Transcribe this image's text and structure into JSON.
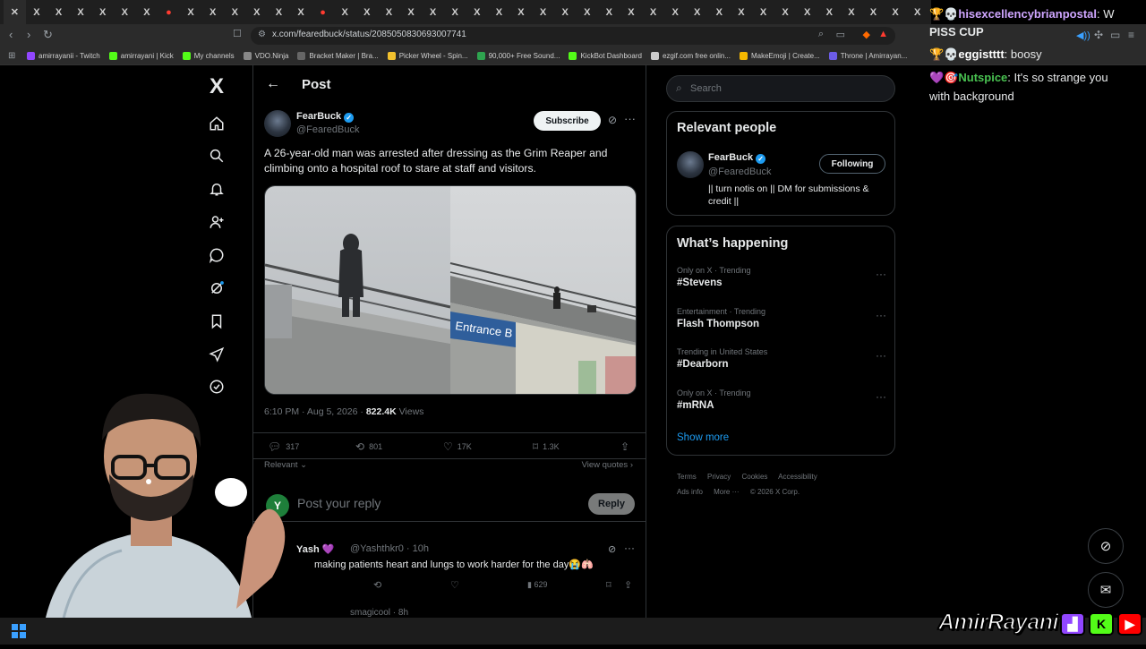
{
  "browser": {
    "url": "x.com/fearedbuck/status/2085050830693007741",
    "tab_favicon_letters": [
      "✕",
      "X",
      "X",
      "X",
      "X",
      "X",
      "X",
      "●",
      "X",
      "X",
      "X",
      "X",
      "X",
      "X",
      "●",
      "X",
      "X",
      "X",
      "X",
      "X",
      "X",
      "X",
      "X",
      "X",
      "X",
      "X",
      "X",
      "X",
      "X",
      "X",
      "X",
      "X",
      "X",
      "X",
      "X",
      "X",
      "X",
      "X",
      "X",
      "X",
      "X",
      "X"
    ],
    "bookmarks": [
      {
        "label": "amirrayanii - Twitch",
        "color": "#9146ff"
      },
      {
        "label": "amirrayani | Kick",
        "color": "#53fc18"
      },
      {
        "label": "My channels",
        "color": "#53fc18"
      },
      {
        "label": "VDO.Ninja",
        "color": "#888888"
      },
      {
        "label": "Bracket Maker | Bra...",
        "color": "#666666"
      },
      {
        "label": "Picker Wheel - Spin...",
        "color": "#f2c12e"
      },
      {
        "label": "90,000+ Free Sound...",
        "color": "#2ea44f"
      },
      {
        "label": "KickBot Dashboard",
        "color": "#53fc18"
      },
      {
        "label": "ezgif.com free onlin...",
        "color": "#cccccc"
      },
      {
        "label": "MakeEmoji | Create...",
        "color": "#f5b800"
      },
      {
        "label": "Throne | Amirrayan...",
        "color": "#6c5ce7"
      }
    ]
  },
  "nav": {
    "logo": "X",
    "icons": [
      "home-icon",
      "search-icon",
      "bell-icon",
      "people-icon",
      "chat-icon",
      "grok-icon",
      "bookmark-icon",
      "rocket-icon",
      "verified-icon"
    ]
  },
  "post": {
    "header_title": "Post",
    "author_name": "FearBuck",
    "author_handle": "@FearedBuck",
    "subscribe_label": "Subscribe",
    "text": "A 26-year-old man was arrested after dressing as the Grim Reaper and climbing onto a hospital roof to stare at staff and visitors.",
    "media_sign_text": "Entrance B",
    "timestamp": "6:10 PM · Aug 5, 2026 ·",
    "views_count": "822.4K",
    "views_label": "Views",
    "replies": "317",
    "reposts": "801",
    "likes": "17K",
    "bookmarks": "1.3K",
    "relevant_label": "Relevant",
    "view_quotes_label": "View quotes",
    "reply_placeholder": "Post your reply",
    "reply_button": "Reply",
    "reply_avatar_letter": "Y"
  },
  "replies": [
    {
      "name": "Yash 💜",
      "handle": "@Yashthkr0 · 10h",
      "text": "making patients heart and lungs to work harder for the day😭🫁",
      "views": "629"
    },
    {
      "handle": "smagicool · 8h"
    }
  ],
  "right": {
    "search_placeholder": "Search",
    "relevant_people_title": "Relevant people",
    "rp_name": "FearBuck",
    "rp_handle": "@FearedBuck",
    "rp_following": "Following",
    "rp_bio": "|| turn notis on || DM for submissions & credit ||",
    "whats_happening_title": "What’s happening",
    "trends": [
      {
        "context": "Only on X · Trending",
        "name": "#Stevens"
      },
      {
        "context": "Entertainment · Trending",
        "name": "Flash Thompson"
      },
      {
        "context": "Trending in United States",
        "name": "#Dearborn"
      },
      {
        "context": "Only on X · Trending",
        "name": "#mRNA"
      }
    ],
    "show_more": "Show more",
    "footer": [
      "Terms",
      "Privacy",
      "Cookies",
      "Accessibility",
      "Ads info",
      "More ···",
      "© 2026 X Corp."
    ]
  },
  "chat": [
    {
      "user": "hisexcellencybrianpostal",
      "color": "#cfa6ff",
      "text": ": W",
      "badges": "🏆💀"
    },
    {
      "user": "",
      "color": "#ffffff",
      "text": "PISS CUP",
      "badges": ""
    },
    {
      "user": "eggistttt",
      "color": "#ffffff",
      "text": ": boosy",
      "badges": "🏆💀"
    },
    {
      "user": "Nutspice",
      "color": "#49c251",
      "text": ": It's so strange you",
      "badges": "💜🎯"
    },
    {
      "user": "",
      "color": "#ffffff",
      "text": "with  background",
      "badges": ""
    }
  ],
  "brand": {
    "name": "AmirRayani",
    "twitch_color": "#9146ff",
    "kick_color": "#53fc18",
    "youtube_color": "#ff0000"
  },
  "colors": {
    "accent": "#1d9bf0",
    "background": "#000000",
    "muted_text": "#71767b"
  }
}
